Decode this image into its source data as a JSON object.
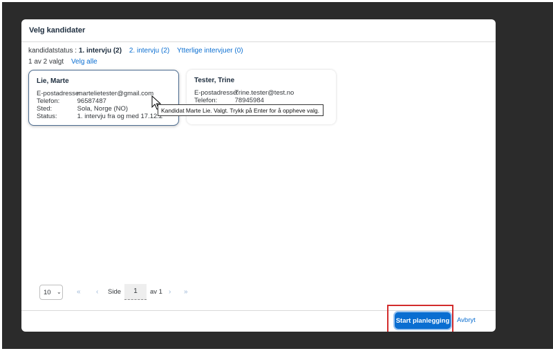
{
  "dialog": {
    "title": "Velg kandidater",
    "status_label": "kandidatstatus :",
    "tabs": [
      {
        "label": "1. intervju (2)",
        "active": true
      },
      {
        "label": "2. intervju (2)",
        "active": false
      },
      {
        "label": "Ytterlige intervjuer (0)",
        "active": false
      }
    ],
    "selection_count": "1 av 2 valgt",
    "select_all": "Velg alle"
  },
  "candidates": [
    {
      "name": "Lie, Marte",
      "selected": true,
      "email_label": "E-postadresse:",
      "email": "martelietester@gmail.com",
      "phone_label": "Telefon:",
      "phone": "96587487",
      "place_label": "Sted:",
      "place": "Sola, Norge (NO)",
      "status_label": "Status:",
      "status": "1. intervju fra og med 17.12.2"
    },
    {
      "name": "Tester, Trine",
      "selected": false,
      "email_label": "E-postadresse:",
      "email": "Trine.tester@test.no",
      "phone_label": "Telefon:",
      "phone": "78945984"
    }
  ],
  "tooltip": "Kandidat Marte Lie. Valgt. Trykk på Enter for å oppheve valg.",
  "pagination": {
    "page_size": "10",
    "page_label": "Side",
    "page": "1",
    "of_label": "av 1"
  },
  "footer": {
    "primary_button": "Start planlegging",
    "cancel_button": "Avbryt"
  },
  "colors": {
    "accent": "#0a6ed1",
    "highlight": "#d22b2b"
  }
}
